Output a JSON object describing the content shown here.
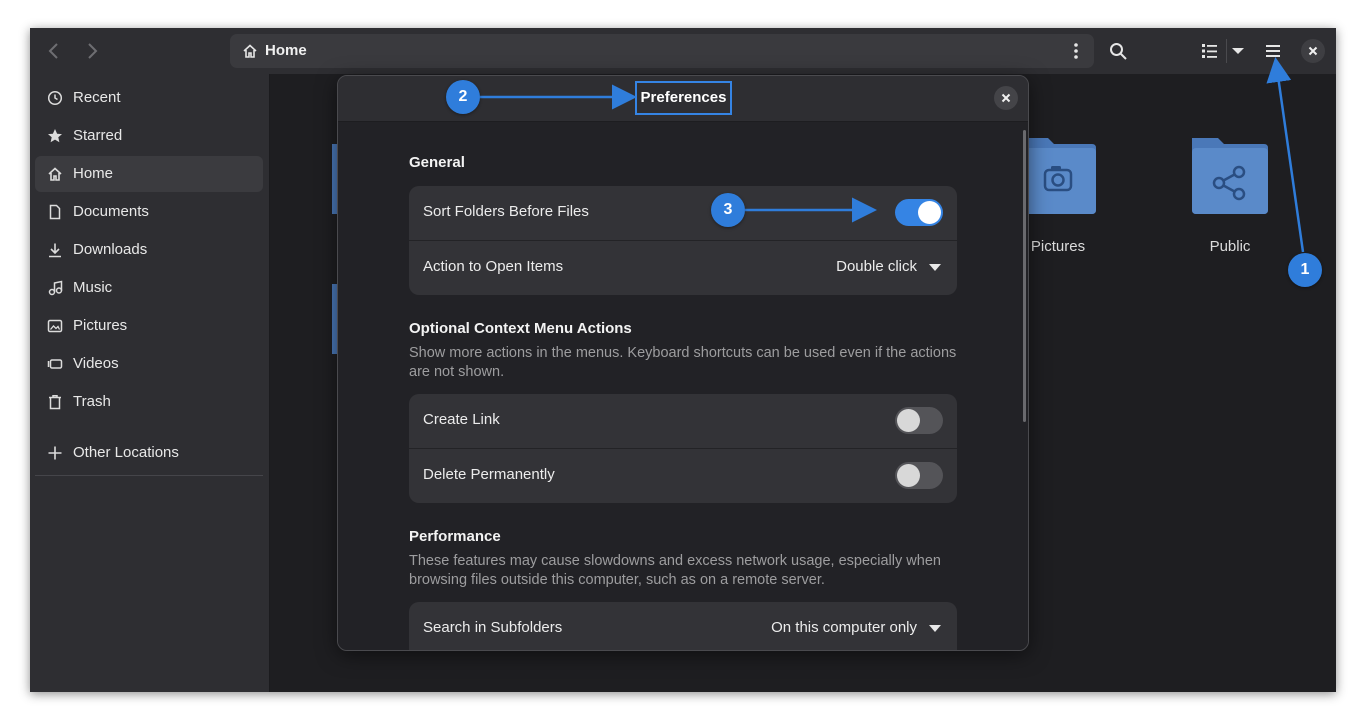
{
  "window": {
    "path_label": "Home"
  },
  "sidebar": {
    "items": [
      {
        "label": "Recent",
        "icon": "clock-icon"
      },
      {
        "label": "Starred",
        "icon": "star-icon"
      },
      {
        "label": "Home",
        "icon": "home-icon",
        "active": true
      },
      {
        "label": "Documents",
        "icon": "document-icon"
      },
      {
        "label": "Downloads",
        "icon": "download-icon"
      },
      {
        "label": "Music",
        "icon": "music-icon"
      },
      {
        "label": "Pictures",
        "icon": "picture-icon"
      },
      {
        "label": "Videos",
        "icon": "video-icon"
      },
      {
        "label": "Trash",
        "icon": "trash-icon"
      }
    ],
    "other_locations": "Other Locations"
  },
  "files": {
    "pictures_label": "Pictures",
    "public_label": "Public"
  },
  "dialog": {
    "title": "Preferences",
    "general": {
      "title": "General",
      "sort_folders": "Sort Folders Before Files",
      "sort_folders_on": true,
      "open_action_label": "Action to Open Items",
      "open_action_value": "Double click"
    },
    "context": {
      "title": "Optional Context Menu Actions",
      "description": "Show more actions in the menus. Keyboard shortcuts can be used even if the actions are not shown.",
      "create_link": "Create Link",
      "create_link_on": false,
      "delete_perm": "Delete Permanently",
      "delete_perm_on": false
    },
    "performance": {
      "title": "Performance",
      "description": "These features may cause slowdowns and excess network usage, especially when browsing files outside this computer, such as on a remote server.",
      "search_sub_label": "Search in Subfolders",
      "search_sub_value": "On this computer only"
    }
  },
  "annotations": {
    "badge_1": "1",
    "badge_2": "2",
    "badge_3": "3",
    "color": "#2f7ddb"
  },
  "colors": {
    "accent": "#3584e4",
    "window_bg": "#222226",
    "headerbar_bg": "#2e2e32",
    "folder_blue": "#4a78b8"
  }
}
